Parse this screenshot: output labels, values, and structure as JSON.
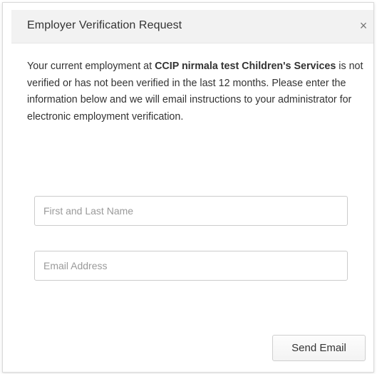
{
  "dialog": {
    "title": "Employer Verification Request",
    "close_glyph": "×",
    "message": {
      "prefix": "Your current employment at ",
      "employer": "CCIP nirmala test Children's Services",
      "suffix": " is not verified or has not been verified in the last 12 months. Please enter the information below and we will email instructions to your administrator for electronic employment verification."
    },
    "name_field": {
      "placeholder": "First and Last Name",
      "value": ""
    },
    "email_field": {
      "placeholder": "Email Address",
      "value": ""
    },
    "send_label": "Send Email"
  },
  "icons": {
    "close": "close-icon"
  },
  "colors": {
    "header_bg": "#f2f2f2",
    "border": "#cccccc",
    "text": "#333333",
    "placeholder": "#9a9a9a"
  }
}
